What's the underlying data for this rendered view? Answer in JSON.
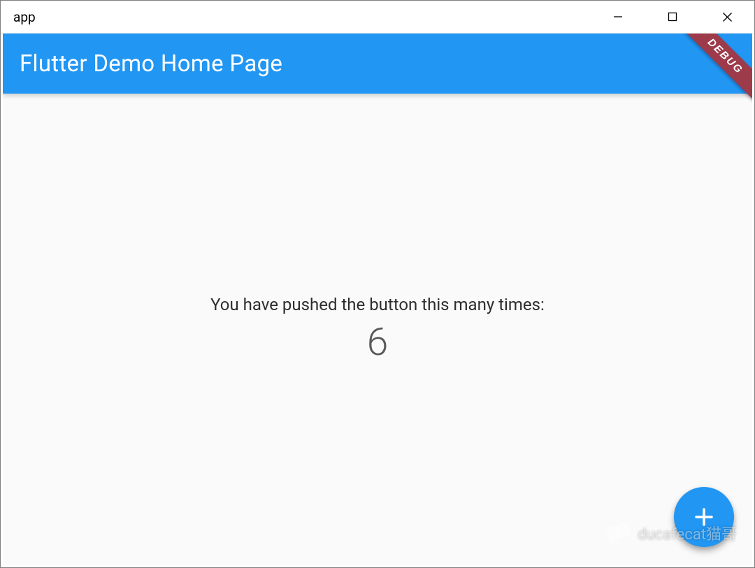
{
  "window": {
    "title": "app"
  },
  "appbar": {
    "title": "Flutter Demo Home Page"
  },
  "debug_banner": "DEBUG",
  "body": {
    "push_text": "You have pushed the button this many times:",
    "counter": "6"
  },
  "watermark": {
    "text": "ducafecat猫哥"
  },
  "colors": {
    "primary": "#2196F3",
    "debug_banner": "#9d3b4b"
  }
}
